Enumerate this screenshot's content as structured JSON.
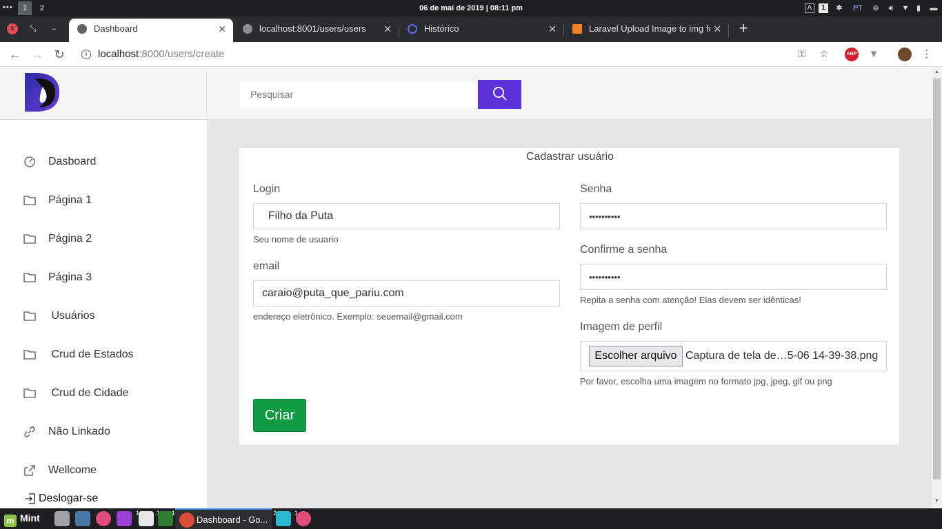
{
  "system_panel": {
    "workspaces": [
      "1",
      "2"
    ],
    "clock": "06 de mai de 2019 | 08:11 pm",
    "tray": {
      "keyboard_box": "A",
      "notification_count": "1",
      "language": "PT"
    }
  },
  "browser": {
    "tabs": [
      {
        "title": "Dashboard",
        "active": true
      },
      {
        "title": "localhost:8001/users/users",
        "active": false
      },
      {
        "title": "Histórico",
        "active": false
      },
      {
        "title": "Laravel Upload Image to img fo",
        "active": false
      }
    ],
    "url": {
      "host": "localhost",
      "rest": ":8000/users/create"
    },
    "abp_label": "ABP"
  },
  "sidebar": {
    "items": [
      {
        "label": "Dasboard",
        "icon": "gauge-icon"
      },
      {
        "label": "Página 1",
        "icon": "folder-icon"
      },
      {
        "label": "Página 2",
        "icon": "folder-icon"
      },
      {
        "label": "Página 3",
        "icon": "folder-icon"
      },
      {
        "label": " Usuários",
        "icon": "folder-icon"
      },
      {
        "label": " Crud de Estados",
        "icon": "folder-icon"
      },
      {
        "label": " Crud de Cidade",
        "icon": "folder-icon"
      },
      {
        "label": "Não Linkado",
        "icon": "link-icon"
      },
      {
        "label": "Wellcome",
        "icon": "external-link-icon"
      }
    ],
    "logout": "Deslogar-se"
  },
  "search": {
    "placeholder": "Pesquisar"
  },
  "form": {
    "title": "Cadastrar usuário",
    "login": {
      "label": "Login",
      "value": "  Filho da Puta",
      "help": "Seu nome de usuario"
    },
    "email": {
      "label": "email",
      "value": "caraio@puta_que_pariu.com",
      "help": "endereço eletrônico. Exemplo: seuemail@gmail.com"
    },
    "password": {
      "label": "Senha",
      "value": "••••••••••"
    },
    "password_confirm": {
      "label": "Confirme a senha",
      "value": "••••••••••",
      "help": "Repita a senha com atenção! Elas devem ser idênticas!"
    },
    "profile_image": {
      "label": "Imagem de perfil",
      "button": "Escolher arquivo",
      "filename": "Captura de tela de…5-06 14-39-38.png",
      "help": "Por favor, escolha uma imagem no formato jpg, jpeg, gif ou png"
    },
    "submit": "Criar"
  },
  "taskbar": {
    "start_label": "Mint",
    "window_label": "Dashboard - Go...",
    "badges": [
      "1",
      "1",
      "1",
      "1",
      "2",
      "1"
    ]
  },
  "colors": {
    "accent": "#5c32d8",
    "submit": "#109a42",
    "page_bg": "#e6e6e6",
    "panel_bg": "#1e1f22"
  }
}
